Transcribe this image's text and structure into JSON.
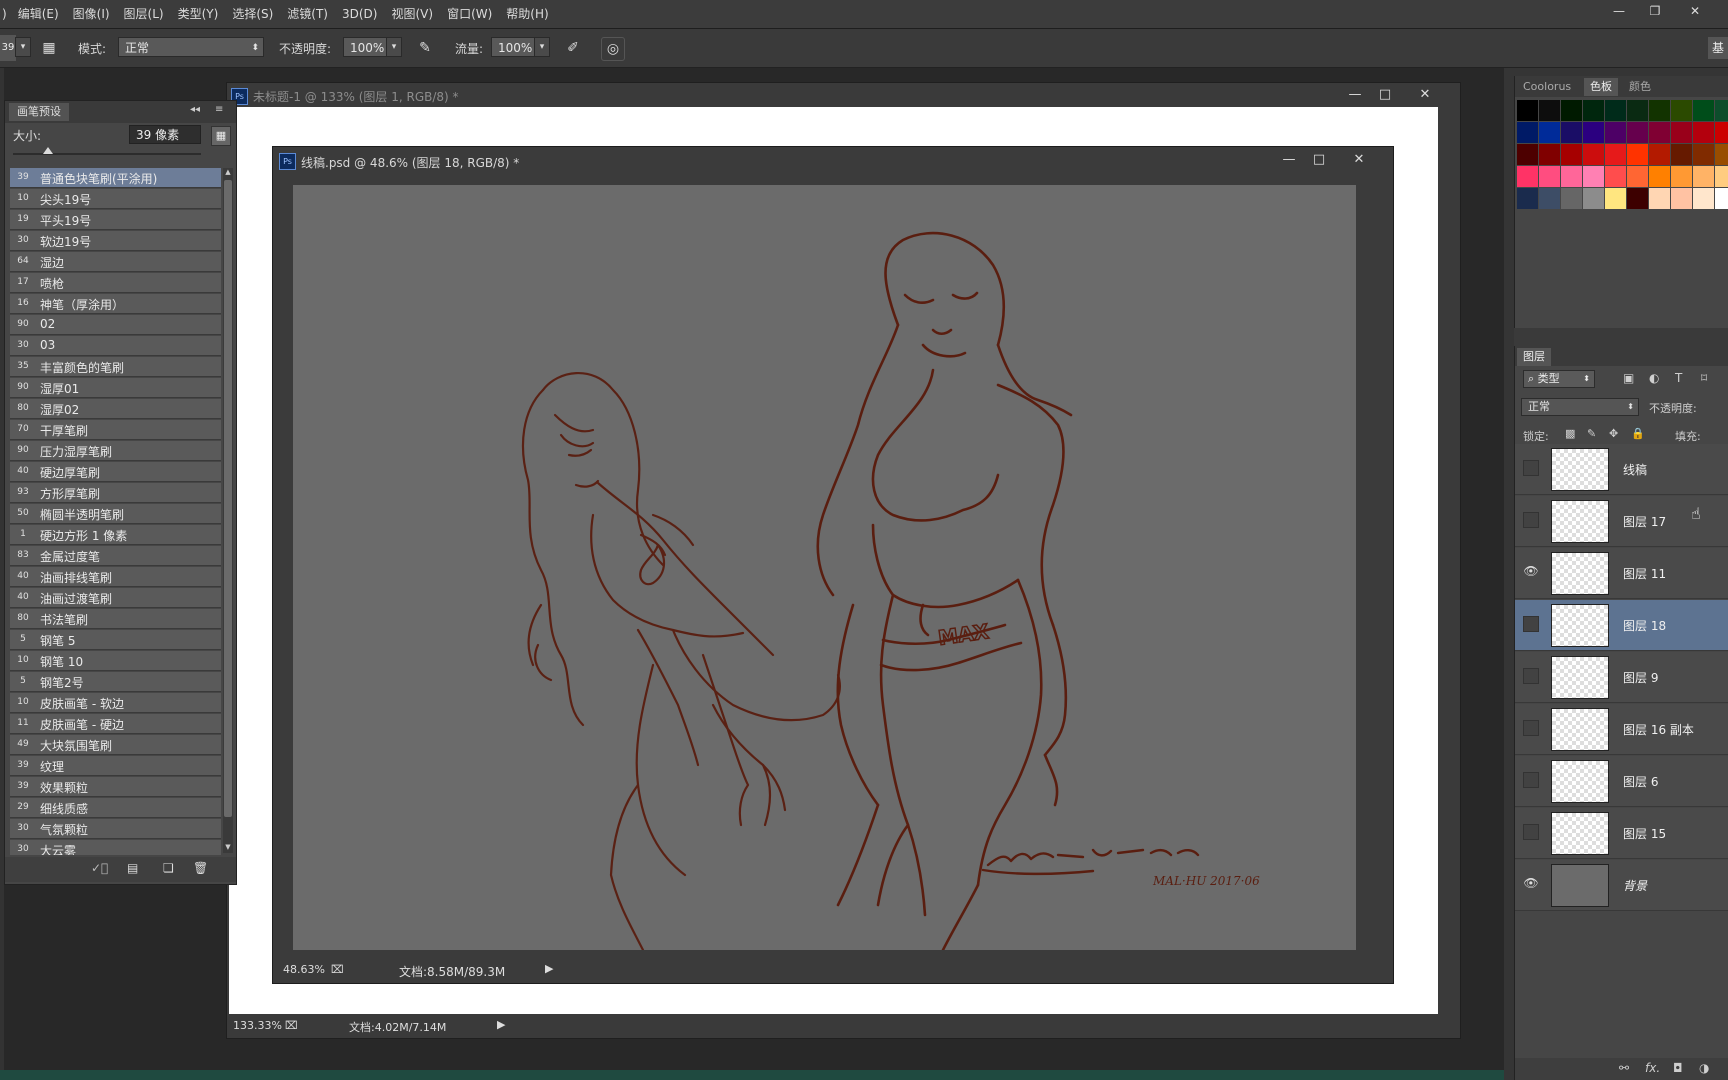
{
  "menu": [
    "编辑(E)",
    "图像(I)",
    "图层(L)",
    "类型(Y)",
    "选择(S)",
    "滤镜(T)",
    "3D(D)",
    "视图(V)",
    "窗口(W)",
    "帮助(H)"
  ],
  "options": {
    "brush_size_short": "39",
    "mode_label": "模式:",
    "mode_value": "正常",
    "opacity_label": "不透明度:",
    "opacity_value": "100%",
    "flow_label": "流量:",
    "flow_value": "100%",
    "right_edge_text": "基"
  },
  "brush_panel": {
    "tab": "画笔预设",
    "size_label": "大小:",
    "size_value": "39 像素",
    "brushes": [
      {
        "num": "39",
        "name": "普通色块笔刷(平涂用)",
        "selected": true
      },
      {
        "num": "10",
        "name": "尖头19号"
      },
      {
        "num": "19",
        "name": "平头19号"
      },
      {
        "num": "30",
        "name": "软边19号"
      },
      {
        "num": "64",
        "name": "湿边"
      },
      {
        "num": "17",
        "name": "喷枪"
      },
      {
        "num": "16",
        "name": "神笔（厚涂用）"
      },
      {
        "num": "90",
        "name": "02"
      },
      {
        "num": "30",
        "name": "03"
      },
      {
        "num": "35",
        "name": "丰富颜色的笔刷"
      },
      {
        "num": "90",
        "name": "湿厚01"
      },
      {
        "num": "80",
        "name": "湿厚02"
      },
      {
        "num": "70",
        "name": "干厚笔刷"
      },
      {
        "num": "90",
        "name": "压力湿厚笔刷"
      },
      {
        "num": "40",
        "name": "硬边厚笔刷"
      },
      {
        "num": "93",
        "name": "方形厚笔刷"
      },
      {
        "num": "50",
        "name": "椭圆半透明笔刷"
      },
      {
        "num": "1",
        "name": "硬边方形 1 像素"
      },
      {
        "num": "83",
        "name": "金属过度笔"
      },
      {
        "num": "40",
        "name": "油画排线笔刷"
      },
      {
        "num": "40",
        "name": "油画过渡笔刷"
      },
      {
        "num": "80",
        "name": "书法笔刷"
      },
      {
        "num": "5",
        "name": "钢笔 5"
      },
      {
        "num": "10",
        "name": "钢笔 10"
      },
      {
        "num": "5",
        "name": "钢笔2号"
      },
      {
        "num": "10",
        "name": "皮肤画笔 - 软边"
      },
      {
        "num": "11",
        "name": "皮肤画笔 - 硬边"
      },
      {
        "num": "49",
        "name": "大块氛围笔刷"
      },
      {
        "num": "39",
        "name": "纹理"
      },
      {
        "num": "39",
        "name": "效果颗粒"
      },
      {
        "num": "29",
        "name": "细线质感"
      },
      {
        "num": "30",
        "name": "气氛颗粒"
      },
      {
        "num": "30",
        "name": "大云雾"
      }
    ]
  },
  "doc_back": {
    "title": "未标题-1 @ 133% (图层 1, RGB/8) *",
    "zoom": "133.33%",
    "doc_size": "文档:4.02M/7.14M"
  },
  "doc_front": {
    "title": "线稿.psd @ 48.6% (图层 18, RGB/8) *",
    "zoom": "48.63%",
    "doc_size": "文档:8.58M/89.3M",
    "signature": "MAL·HU 2017·06",
    "shorts_text": "MAX"
  },
  "swatches_panel": {
    "tabs": [
      "Coolorus",
      "色板",
      "颜色"
    ],
    "active_tab": "色板",
    "rows": [
      [
        "#000000",
        "#0d0d0d",
        "#001a00",
        "#00260d",
        "#002b1a",
        "#0a2a12",
        "#123300",
        "#2b4a00",
        "#004d1a",
        "#0d4d2b",
        "#1a3d00",
        "#26590d"
      ],
      [
        "#001a66",
        "#002b99",
        "#1a0d66",
        "#2b0080",
        "#4d0066",
        "#66004d",
        "#800033",
        "#99001a",
        "#b3000d",
        "#cc0000",
        "#e6001a",
        "#ff0033"
      ],
      [
        "#4d0000",
        "#800000",
        "#a60000",
        "#cc0d0d",
        "#e61a1a",
        "#ff3300",
        "#b31a00",
        "#661a00",
        "#802b00",
        "#994d00",
        "#b36600",
        "#cc8000"
      ],
      [
        "#ff3366",
        "#ff4d80",
        "#ff6699",
        "#ff80b3",
        "#ff4d4d",
        "#ff6633",
        "#ff8000",
        "#ff9933",
        "#ffb366",
        "#ffcc80",
        "#ffd699",
        "#ffe0b3"
      ],
      [
        "#1a2b4d",
        "#3d4d66",
        "#666666",
        "#8c8c8c",
        "#ffe680",
        "#3d0000",
        "#ffd6b3",
        "#ffc2a3",
        "#ffe6cc",
        "#ffffff",
        "#f2f2f2",
        "#e6e6e6"
      ]
    ]
  },
  "layers_panel": {
    "tab": "图层",
    "filter_label": "类型",
    "blend_mode": "正常",
    "opacity_label": "不透明度:",
    "lock_label": "锁定:",
    "fill_label": "填充:",
    "layers": [
      {
        "name": "线稿",
        "visible": false,
        "selected": false
      },
      {
        "name": "图层 17",
        "visible": false,
        "selected": false
      },
      {
        "name": "图层 11",
        "visible": true,
        "selected": false
      },
      {
        "name": "图层 18",
        "visible": false,
        "selected": true
      },
      {
        "name": "图层 9",
        "visible": false,
        "selected": false
      },
      {
        "name": "图层 16 副本",
        "visible": false,
        "selected": false
      },
      {
        "name": "图层 6",
        "visible": false,
        "selected": false
      },
      {
        "name": "图层 15",
        "visible": false,
        "selected": false
      },
      {
        "name": "背景",
        "visible": true,
        "selected": false
      }
    ]
  },
  "colors": {
    "selection": "#6d7d98",
    "layer_selection": "#5d7391",
    "line_art": "#5a1e10"
  }
}
